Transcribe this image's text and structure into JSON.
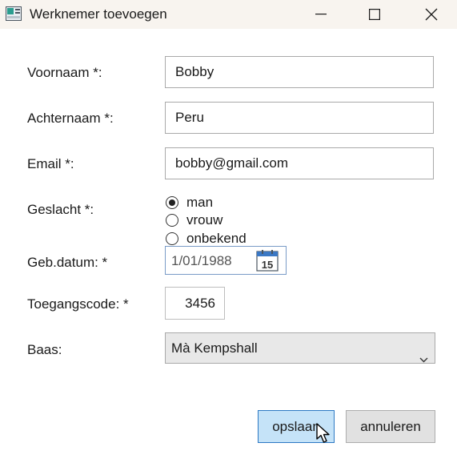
{
  "window": {
    "title": "Werknemer toevoegen"
  },
  "form": {
    "firstname": {
      "label": "Voornaam *:",
      "value": "Bobby"
    },
    "lastname": {
      "label": "Achternaam *:",
      "value": "Peru"
    },
    "email": {
      "label": "Email *:",
      "value": "bobby@gmail.com"
    },
    "gender": {
      "label": "Geslacht *:",
      "options": [
        "man",
        "vrouw",
        "onbekend"
      ],
      "selected": "man"
    },
    "birthdate": {
      "label": "Geb.datum: *",
      "value": "1/01/1988",
      "calendar_day": "15"
    },
    "accesscode": {
      "label": "Toegangscode: *",
      "value": "3456"
    },
    "boss": {
      "label": "Baas:",
      "value": "Mà Kempshall"
    }
  },
  "buttons": {
    "save": "opslaan",
    "cancel": "annuleren"
  },
  "colors": {
    "titlebar": "#f8f4ef",
    "save_bg": "#c5e3f8",
    "save_border": "#2d79c4",
    "calendar_blue": "#3b78c4"
  }
}
